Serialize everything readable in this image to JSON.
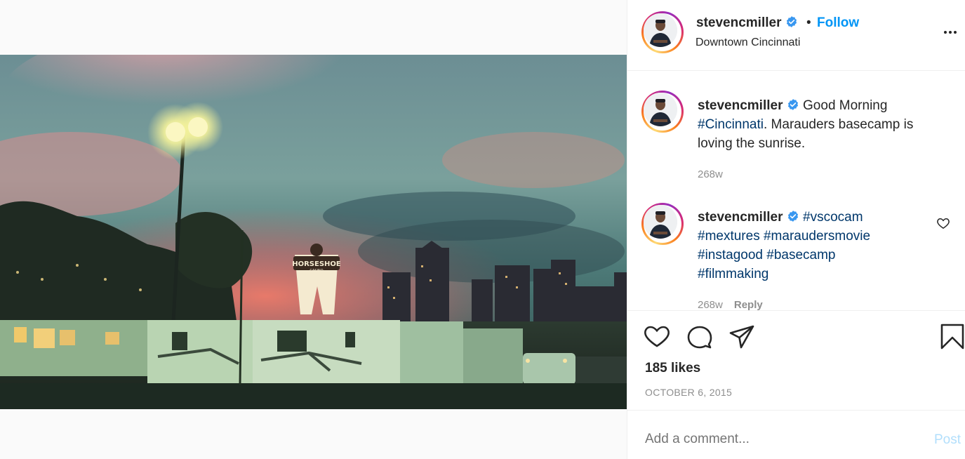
{
  "post": {
    "username": "stevencmiller",
    "follow_label": "Follow",
    "separator": "•",
    "location": "Downtown Cincinnati",
    "likes": "185 likes",
    "date": "OCTOBER 6, 2015"
  },
  "comments": [
    {
      "username": "stevencmiller",
      "text_before": "Good Morning ",
      "hashtag": "#Cincinnati",
      "text_after": ". Marauders basecamp is loving the sunrise.",
      "time": "268w"
    },
    {
      "username": "stevencmiller",
      "hashtags_line1": "#vscocam",
      "hashtags_line2": "#mextures #maraudersmovie",
      "hashtags_line3": "#instagood #basecamp",
      "hashtags_line4": "#filmmaking",
      "time": "268w",
      "reply_label": "Reply"
    }
  ],
  "comment_box": {
    "placeholder": "Add a comment...",
    "post_label": "Post"
  },
  "photo": {
    "sign_text": "HORSESHOE",
    "sign_subtext": "CASINO"
  },
  "icons": {
    "verified": "verified-badge-icon",
    "more": "more-options-icon",
    "like": "heart-icon",
    "comment": "comment-bubble-icon",
    "share": "paper-plane-icon",
    "save": "bookmark-icon"
  },
  "colors": {
    "follow": "#0095f6",
    "hashtag": "#00376b",
    "muted": "#8e8e8e",
    "post_disabled": "#b2dffc",
    "verified": "#3897f0"
  }
}
